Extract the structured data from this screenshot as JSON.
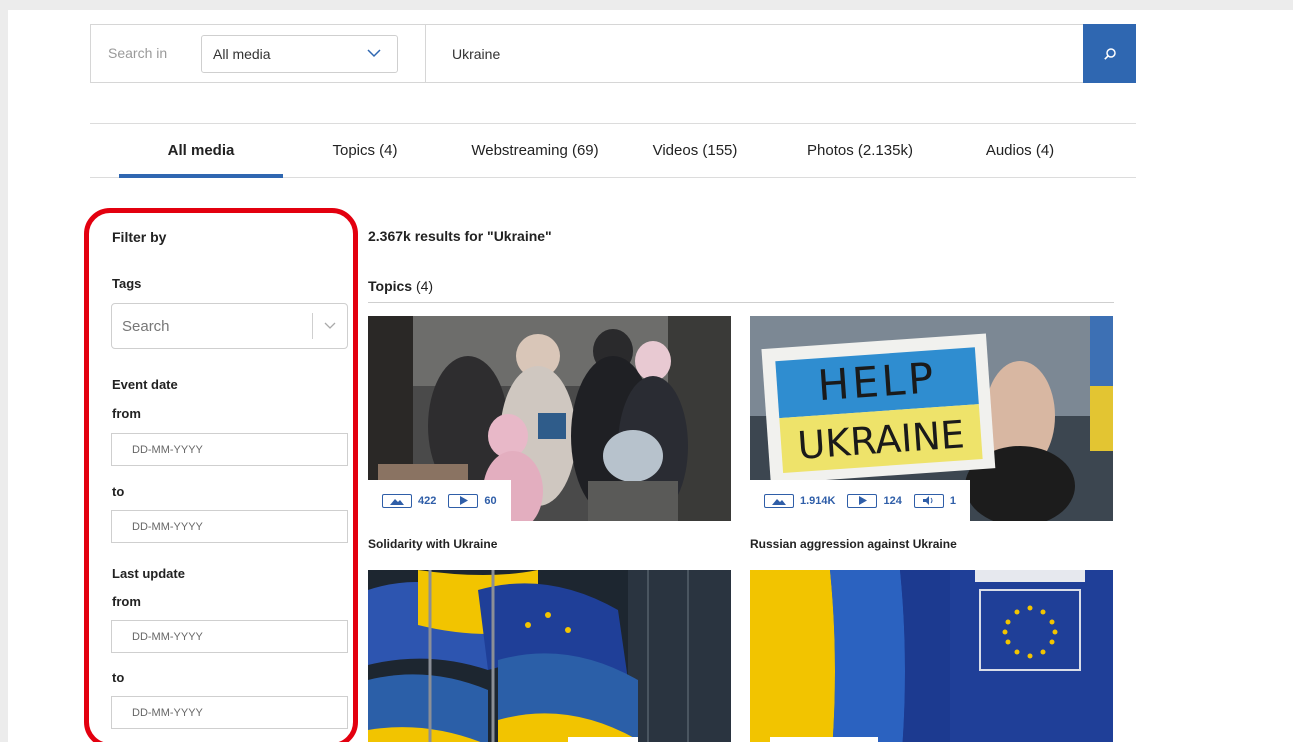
{
  "search": {
    "search_in_label": "Search in",
    "media_selected": "All media",
    "query": "Ukraine",
    "button_icon": "search-icon"
  },
  "tabs": [
    {
      "label": "All media",
      "active": true
    },
    {
      "label": "Topics (4)"
    },
    {
      "label": "Webstreaming (69)"
    },
    {
      "label": "Videos (155)"
    },
    {
      "label": "Photos (2.135k)"
    },
    {
      "label": "Audios (4)"
    }
  ],
  "filters": {
    "heading": "Filter by",
    "tags_label": "Tags",
    "tags_placeholder": "Search",
    "event_date_label": "Event date",
    "from_label": "from",
    "to_label": "to",
    "last_update_label": "Last update",
    "date_placeholder": "DD-MM-YYYY"
  },
  "results": {
    "summary": "2.367k results for \"Ukraine\"",
    "section_name": "Topics",
    "section_count": "(4)",
    "cards": [
      {
        "title": "Solidarity with Ukraine",
        "photos": "422",
        "videos": "60"
      },
      {
        "title": "Russian aggression against Ukraine",
        "photos": "1.914K",
        "videos": "124",
        "audios": "1"
      },
      {
        "title": ""
      },
      {
        "title": ""
      }
    ]
  },
  "colors": {
    "accent": "#2f67b1",
    "highlight": "#e3000f",
    "ukraine_blue": "#2b5fa8",
    "ukraine_yellow": "#f2c400",
    "eu_blue": "#1f3f98"
  }
}
